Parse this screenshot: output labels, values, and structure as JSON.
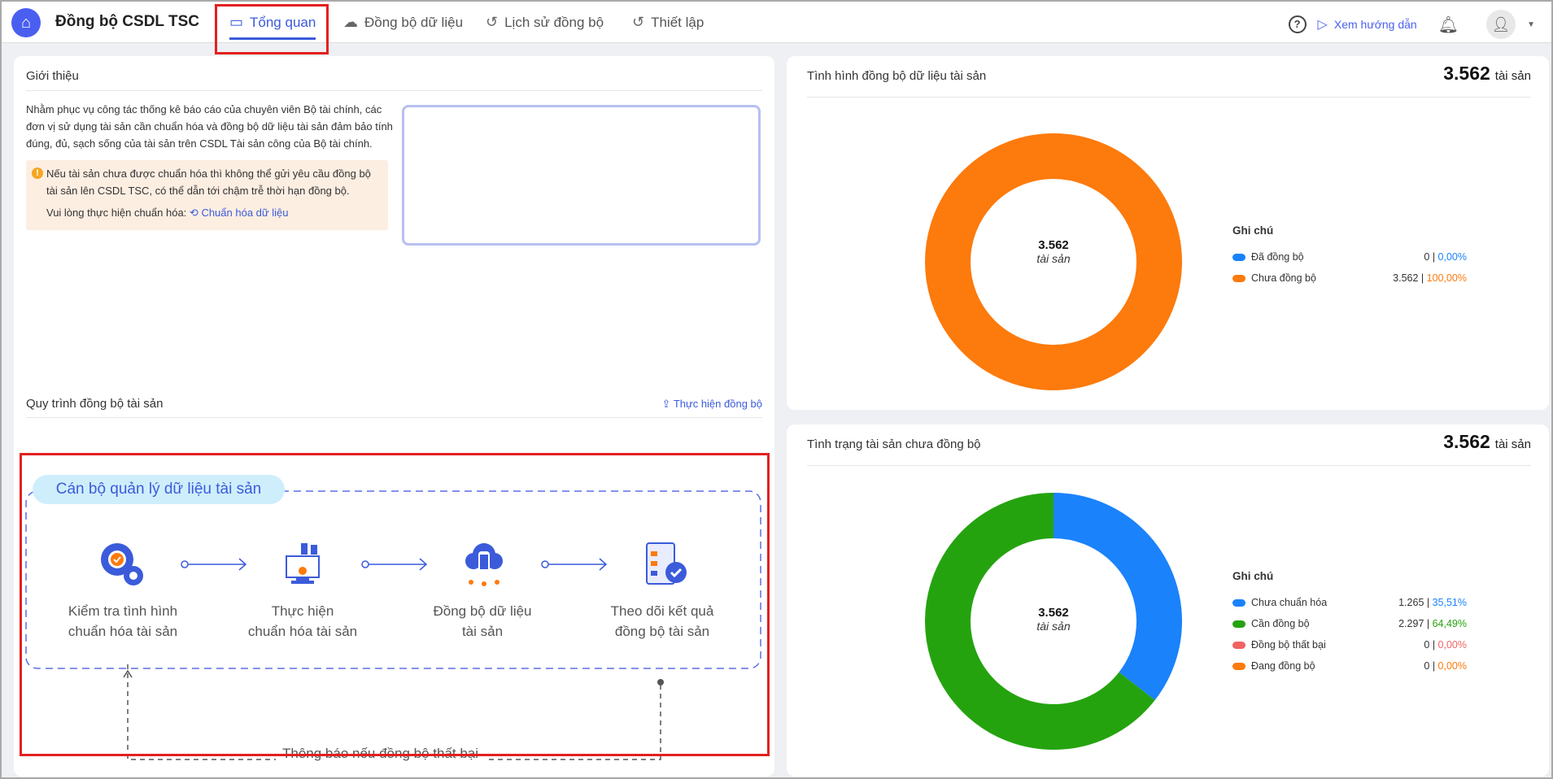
{
  "header": {
    "app_title": "Đồng bộ CSDL TSC",
    "tabs": [
      {
        "label": "Tổng quan",
        "active": true
      },
      {
        "label": "Đồng bộ dữ liệu"
      },
      {
        "label": "Lịch sử đồng bộ"
      },
      {
        "label": "Thiết lập"
      }
    ],
    "help_icon": "?",
    "guide_label": "Xem hướng dẫn"
  },
  "intro": {
    "title": "Giới thiệu",
    "text": "Nhằm phục vụ công tác thống kê báo cáo của chuyên viên Bộ tài chính, các đơn vị sử dụng tài sản cần chuẩn hóa và đồng bộ dữ liệu tài sản đảm bảo tính đúng, đủ, sạch sống của tài sản trên CSDL Tài sản công của Bộ tài chính.",
    "warning": "Nếu tài sản chưa được chuẩn hóa thì không thể gửi yêu cầu đồng bộ tài sản lên CSDL TSC, có thể dẫn tới chậm trễ thời hạn đồng bộ.",
    "prompt": "Vui lòng thực hiện chuẩn hóa:",
    "link": "Chuẩn hóa dữ liệu"
  },
  "process": {
    "title": "Quy trình đồng bộ tài sản",
    "action": "Thực hiện đồng bộ",
    "role": "Cán bộ quản lý dữ liệu tài sản",
    "steps": [
      {
        "line1": "Kiểm tra tình hình",
        "line2": "chuẩn hóa tài sản"
      },
      {
        "line1": "Thực hiện",
        "line2": "chuẩn hóa tài sản"
      },
      {
        "line1": "Đồng bộ dữ liệu",
        "line2": "tài sản"
      },
      {
        "line1": "Theo dõi kết quả",
        "line2": "đồng bộ tài sản"
      }
    ],
    "feedback": "Thông báo nếu đồng bộ thất bại"
  },
  "sync_status": {
    "title": "Tình hình đồng bộ dữ liệu tài sản",
    "total": "3.562",
    "unit": "tài sản",
    "center_num": "3.562",
    "center_unit": "tài sản",
    "legend_title": "Ghi chú",
    "items": [
      {
        "name": "Đã đồng bộ",
        "count": "0",
        "pct": "0,00%",
        "value": 0,
        "color": "#1a82fb"
      },
      {
        "name": "Chưa đồng bộ",
        "count": "3.562",
        "pct": "100,00%",
        "value": 100,
        "color": "#fd7a0c"
      }
    ]
  },
  "unsynced": {
    "title": "Tình trạng tài sản chưa đồng bộ",
    "total": "3.562",
    "unit": "tài sản",
    "center_num": "3.562",
    "center_unit": "tài sản",
    "legend_title": "Ghi chú",
    "items": [
      {
        "name": "Chưa chuẩn hóa",
        "count": "1.265",
        "pct": "35,51%",
        "value": 35.51,
        "color": "#1a82fb"
      },
      {
        "name": "Cần đồng bộ",
        "count": "2.297",
        "pct": "64,49%",
        "value": 64.49,
        "color": "#25a30f"
      },
      {
        "name": "Đồng bộ thất bại",
        "count": "0",
        "pct": "0,00%",
        "value": 0,
        "color": "#f06363"
      },
      {
        "name": "Đang đồng bộ",
        "count": "0",
        "pct": "0,00%",
        "value": 0,
        "color": "#fd7a0c"
      }
    ]
  }
}
